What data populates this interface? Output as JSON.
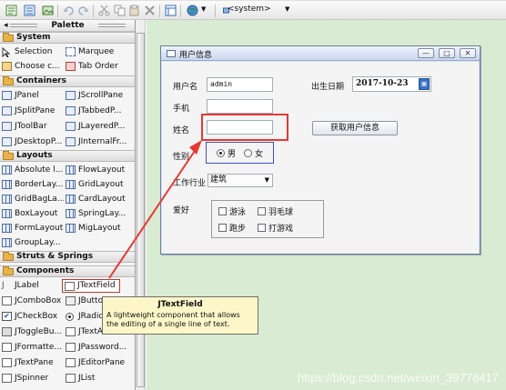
{
  "toolbar": {
    "system_combo": "<system>",
    "colors": {
      "arrow": "#e53935"
    }
  },
  "palette": {
    "title": "Palette",
    "categories": {
      "system": "System",
      "containers": "Containers",
      "layouts": "Layouts",
      "struts": "Struts & Springs",
      "components": "Components"
    },
    "system_items": [
      "Selection",
      "Marquee",
      "Choose c...",
      "Tab Order"
    ],
    "containers_items": [
      "JPanel",
      "JScrollPane",
      "JSplitPane",
      "JTabbedP...",
      "JToolBar",
      "JLayeredP...",
      "JDesktopP...",
      "JInternalFr..."
    ],
    "layouts_items": [
      "Absolute l...",
      "FlowLayout",
      "BorderLay...",
      "GridLayout",
      "GridBagLa...",
      "CardLayout",
      "BoxLayout",
      "SpringLay...",
      "FormLayout",
      "MigLayout",
      "GroupLay..."
    ],
    "components_items": [
      "JLabel",
      "JTextField",
      "JComboBox",
      "JButton",
      "JCheckBox",
      "JRadio...",
      "JToggleBu...",
      "JTextAr...",
      "JFormatte...",
      "JPassword...",
      "JTextPane",
      "JEditorPane",
      "JSpinner",
      "JList"
    ]
  },
  "frame": {
    "title": "用户信息",
    "user_label": "用户名",
    "user_value": "admin",
    "birth_label": "出生日期",
    "birth_value": "2017-10-23",
    "phone_label": "手机",
    "name_label": "姓名",
    "get_button": "获取用户信息",
    "gender_label": "性别",
    "male": "男",
    "female": "女",
    "industry_label": "工作行业",
    "industry_value": "建筑",
    "hobby_label": "爱好",
    "hobbies": [
      "游泳",
      "羽毛球",
      "跑步",
      "打游戏"
    ]
  },
  "tooltip": {
    "title": "JTextField",
    "description": "A lightweight component that allows the editing of a single line of text."
  },
  "watermark": "https://blog.csdn.net/weixin_39778417"
}
